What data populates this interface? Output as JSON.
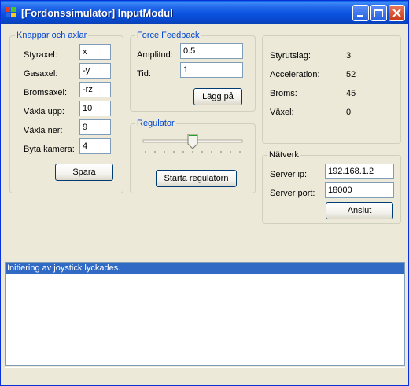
{
  "window": {
    "title": "[Fordonssimulator] InputModul"
  },
  "keys_group": {
    "title": "Knappar och axlar",
    "rows": [
      {
        "label": "Styraxel:",
        "value": "x"
      },
      {
        "label": "Gasaxel:",
        "value": "-y"
      },
      {
        "label": "Bromsaxel:",
        "value": "-rz"
      },
      {
        "label": "Växla upp:",
        "value": "10"
      },
      {
        "label": "Växla ner:",
        "value": "9"
      },
      {
        "label": "Byta kamera:",
        "value": "4"
      }
    ],
    "save_label": "Spara"
  },
  "force_feedback": {
    "title": "Force Feedback",
    "amplitude_label": "Amplitud:",
    "amplitude_value": "0.5",
    "time_label": "Tid:",
    "time_value": "1",
    "apply_label": "Lägg på"
  },
  "regulator": {
    "title": "Regulator",
    "slider_level": 0.5,
    "start_label": "Starta regulatorn"
  },
  "status": {
    "rows": [
      {
        "label": "Styrutslag:",
        "value": "3"
      },
      {
        "label": "Acceleration:",
        "value": "52"
      },
      {
        "label": "Broms:",
        "value": "45"
      },
      {
        "label": "Växel:",
        "value": "0"
      }
    ]
  },
  "network": {
    "title": "Nätverk",
    "ip_label": "Server ip:",
    "ip_value": "192.168.1.2",
    "port_label": "Server port:",
    "port_value": "18000",
    "connect_label": "Anslut"
  },
  "log": {
    "lines": [
      "Initiering av joystick lyckades."
    ]
  },
  "colors": {
    "group_title": "#0046d5",
    "titlebar": "#0a53e0",
    "selection": "#316ac5"
  }
}
